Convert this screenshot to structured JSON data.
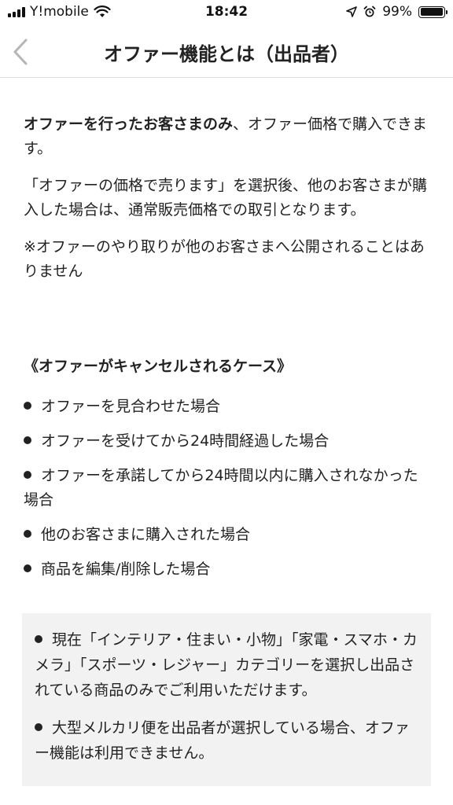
{
  "status_bar": {
    "carrier": "Y!mobile",
    "time": "18:42",
    "battery_percent": "99%",
    "battery_level": 0.99
  },
  "nav": {
    "title": "オファー機能とは（出品者）"
  },
  "content": {
    "intro": {
      "bold": "オファーを行ったお客さまのみ",
      "rest": "、オファー価格で購入できます。"
    },
    "para2": "「オファーの価格で売ります」を選択後、他のお客さまが購入した場合は、通常販売価格での取引となります。",
    "para3": "※オファーのやり取りが他のお客さまへ公開されることはありません",
    "cancel_heading": "《オファーがキャンセルされるケース》",
    "cancel_cases": [
      "オファーを見合わせた場合",
      "オファーを受けてから24時間経過した場合",
      "オファーを承諾してから24時間以内に購入されなかった場合",
      "他のお客さまに購入された場合",
      "商品を編集/削除した場合"
    ],
    "info_box": [
      "現在「インテリア・住まい・小物」「家電・スマホ・カメラ」「スポーツ・レジャー」カテゴリーを選択し出品されている商品のみでご利用いただけます。",
      "大型メルカリ便を出品者が選択している場合、オファー機能は利用できません。"
    ]
  }
}
